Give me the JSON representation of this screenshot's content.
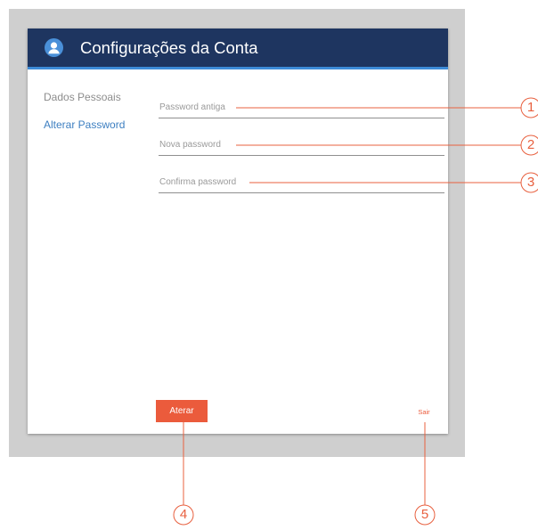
{
  "dialog": {
    "title": "Configurações da Conta",
    "header_color": "#1e3560",
    "accent_color": "#3d8bd8",
    "header_icon": "user-circle-icon"
  },
  "sidebar": {
    "items": [
      {
        "label": "Dados Pessoais",
        "active": false
      },
      {
        "label": "Alterar Password",
        "active": true
      }
    ]
  },
  "form": {
    "fields": [
      {
        "placeholder": "Password antiga",
        "value": ""
      },
      {
        "placeholder": "Nova password",
        "value": ""
      },
      {
        "placeholder": "Confirma password",
        "value": ""
      }
    ],
    "submit_label": "Aterar",
    "exit_label": "Sair",
    "button_color": "#eb5b3c"
  },
  "callouts": [
    "1",
    "2",
    "3",
    "4",
    "5"
  ],
  "callout_color": "#e8603f"
}
